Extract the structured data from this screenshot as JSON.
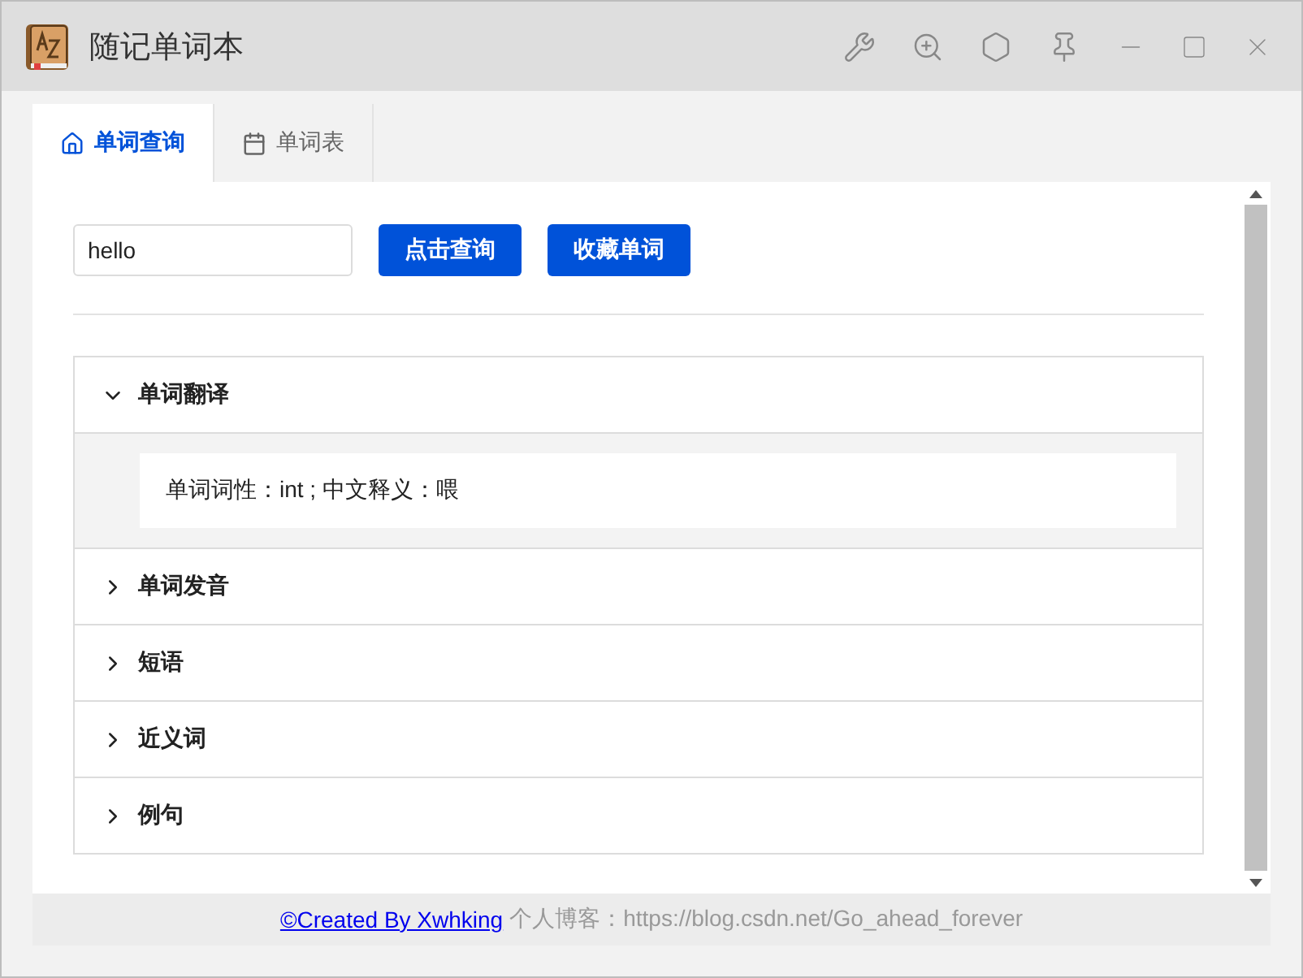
{
  "window": {
    "title": "随记单词本"
  },
  "tabs": [
    {
      "label": "单词查询",
      "selected": true
    },
    {
      "label": "单词表",
      "selected": false
    }
  ],
  "search": {
    "value": "hello"
  },
  "buttons": [
    "点击查询",
    "收藏单词"
  ],
  "sections": [
    {
      "title": "单词翻译",
      "expanded": true,
      "content": "单词词性：int ; 中文释义：喂"
    },
    {
      "title": "单词发音",
      "expanded": false
    },
    {
      "title": "短语",
      "expanded": false
    },
    {
      "title": "近义词",
      "expanded": false
    },
    {
      "title": "例句",
      "expanded": false
    }
  ],
  "footer": {
    "link": "©Created By Xwhking",
    "text": "个人博客：https://blog.csdn.net/Go_ahead_forever"
  }
}
